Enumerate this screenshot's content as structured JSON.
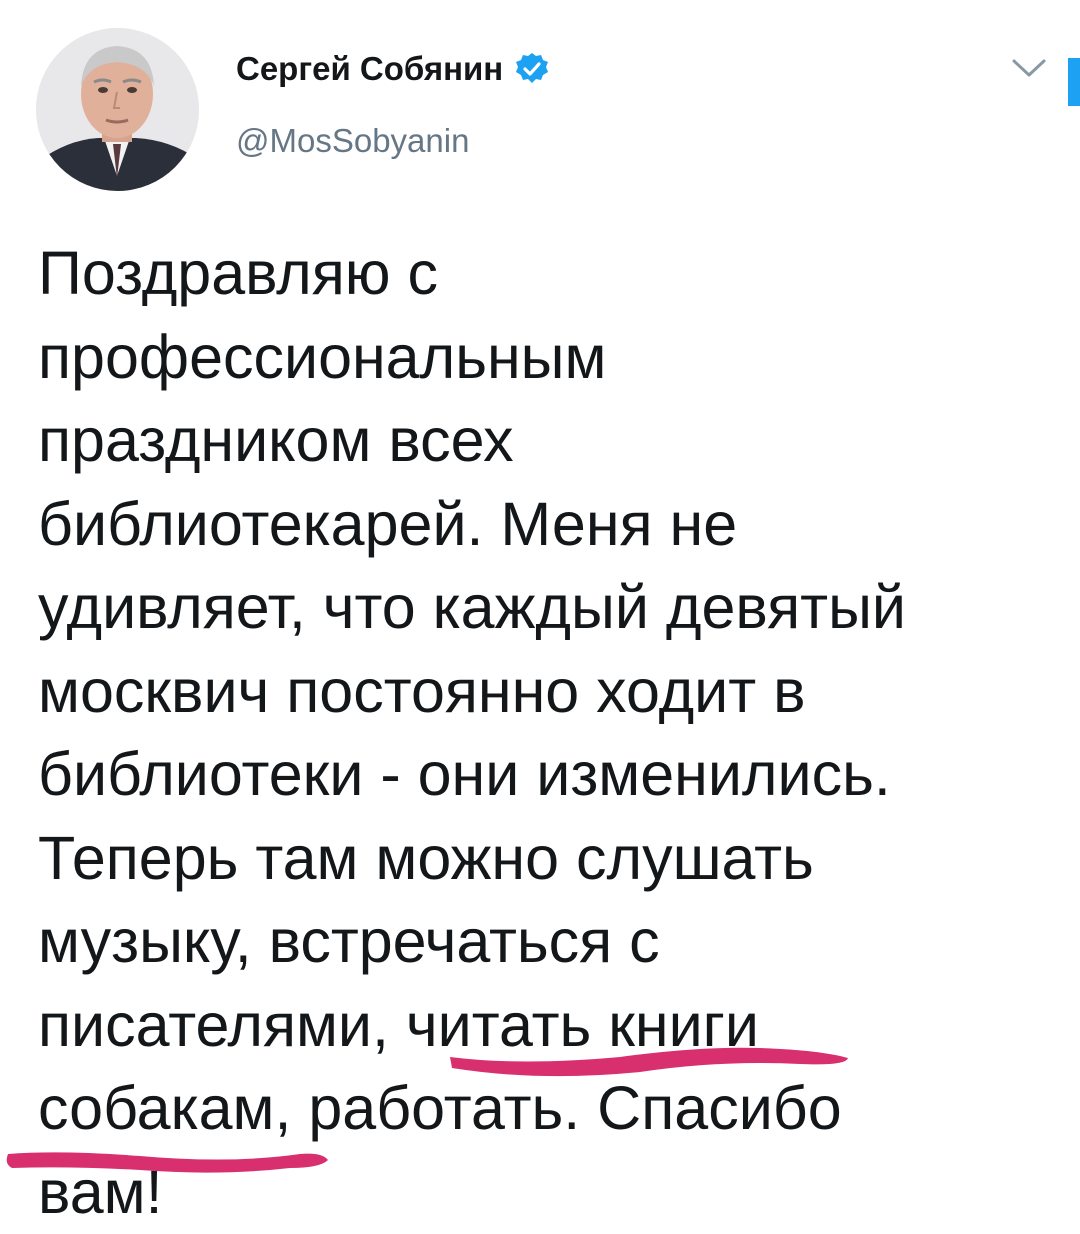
{
  "tweet": {
    "author": {
      "name": "Сергей Собянин",
      "handle": "@MosSobyanin",
      "verified": true,
      "avatar_icon": "person-photo"
    },
    "menu_icon": "chevron-down-icon",
    "lines": [
      "Поздравляю с",
      "профессиональным",
      "праздником всех",
      "библиотекарей. Меня не",
      "удивляет, что каждый девятый",
      "москвич постоянно ходит в",
      "библиотеки - они изменились.",
      "Теперь там можно слушать",
      "музыку, встречаться с",
      "писателями, читать книги",
      "собакам, работать. Спасибо",
      "вам!"
    ]
  },
  "colors": {
    "text": "#14171a",
    "handle": "#657786",
    "verified": "#1da1f2",
    "underline_marker": "#d8306f"
  }
}
